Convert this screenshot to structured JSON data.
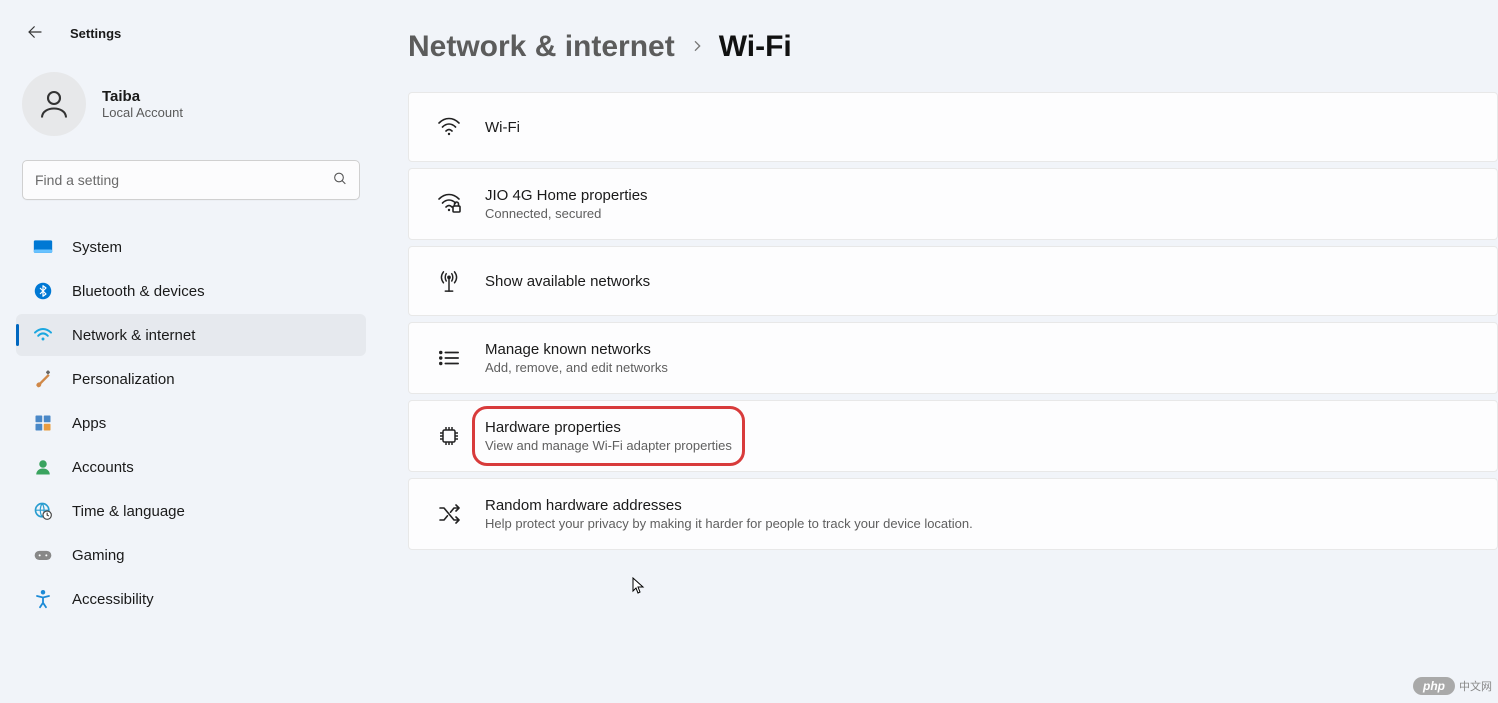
{
  "header": {
    "app_title": "Settings"
  },
  "profile": {
    "name": "Taiba",
    "sub": "Local Account"
  },
  "search": {
    "placeholder": "Find a setting"
  },
  "sidebar": {
    "items": [
      {
        "label": "System"
      },
      {
        "label": "Bluetooth & devices"
      },
      {
        "label": "Network & internet"
      },
      {
        "label": "Personalization"
      },
      {
        "label": "Apps"
      },
      {
        "label": "Accounts"
      },
      {
        "label": "Time & language"
      },
      {
        "label": "Gaming"
      },
      {
        "label": "Accessibility"
      }
    ]
  },
  "breadcrumb": {
    "parent": "Network & internet",
    "current": "Wi-Fi"
  },
  "cards": {
    "wifi": {
      "title": "Wi-Fi"
    },
    "network_props": {
      "title": "JIO 4G Home properties",
      "sub": "Connected, secured"
    },
    "available": {
      "title": "Show available networks"
    },
    "known": {
      "title": "Manage known networks",
      "sub": "Add, remove, and edit networks"
    },
    "hardware": {
      "title": "Hardware properties",
      "sub": "View and manage Wi-Fi adapter properties"
    },
    "random": {
      "title": "Random hardware addresses",
      "sub": "Help protect your privacy by making it harder for people to track your device location."
    }
  },
  "watermark": {
    "brand": "php",
    "cn": "中文网"
  }
}
